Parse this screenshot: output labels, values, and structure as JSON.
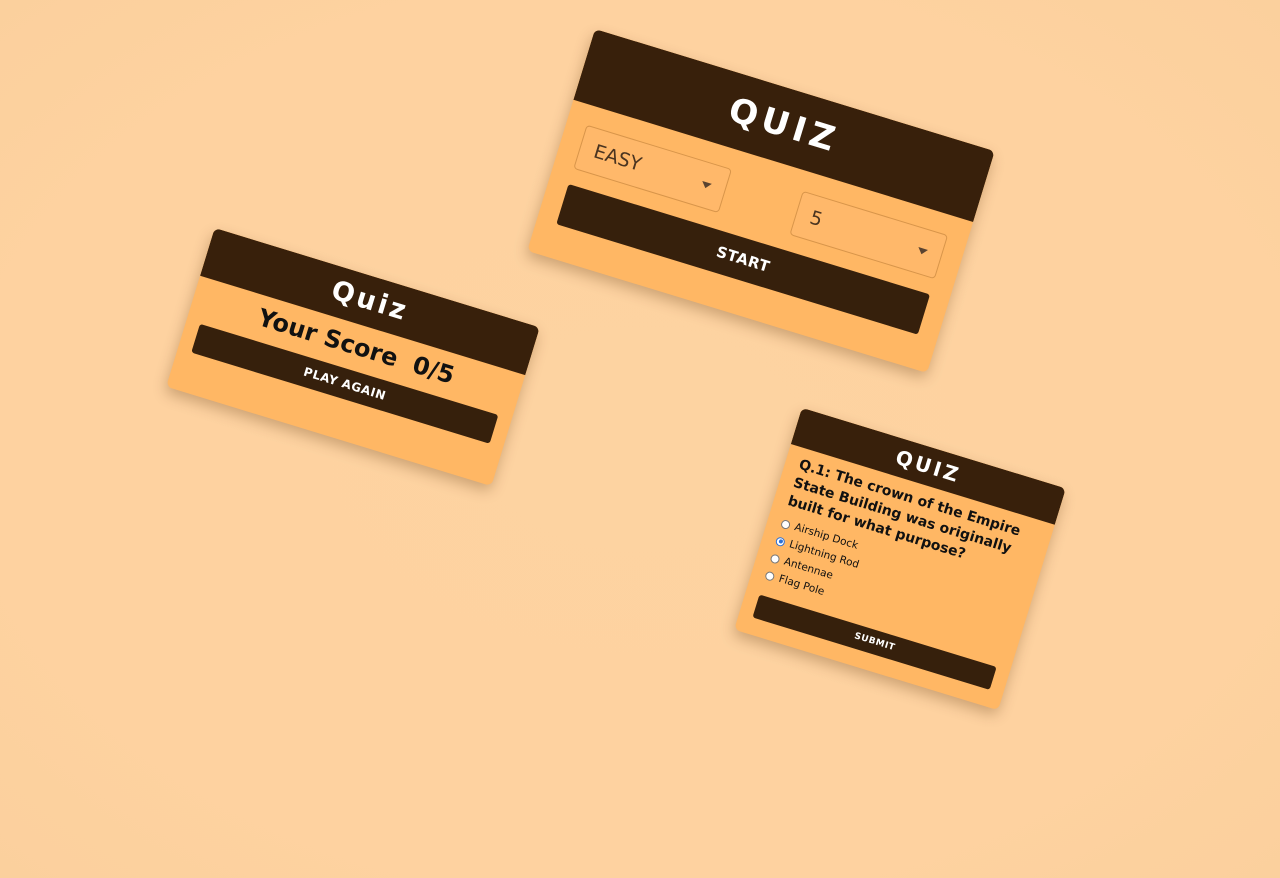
{
  "setup_card": {
    "title": "QUIZ",
    "difficulty_select": {
      "selected": "EASY"
    },
    "count_select": {
      "selected": "5"
    },
    "start_label": "START"
  },
  "score_card": {
    "title": "Quiz",
    "score_label": "Your Score",
    "score_value": "0/5",
    "play_again_label": "PLAY AGAIN"
  },
  "question_card": {
    "title": "QUIZ",
    "question": "Q.1: The crown of the Empire State Building was originally built for what purpose?",
    "options": [
      {
        "label": "Airship Dock",
        "checked": false
      },
      {
        "label": "Lightning Rod",
        "checked": true
      },
      {
        "label": "Antennae",
        "checked": false
      },
      {
        "label": "Flag Pole",
        "checked": false
      }
    ],
    "submit_label": "SUBMIT"
  },
  "colors": {
    "background": "#fdd2a0",
    "card": "#ffb764",
    "header": "#38200b",
    "button": "#36200c",
    "radio_selected": "#2b6fd6"
  }
}
